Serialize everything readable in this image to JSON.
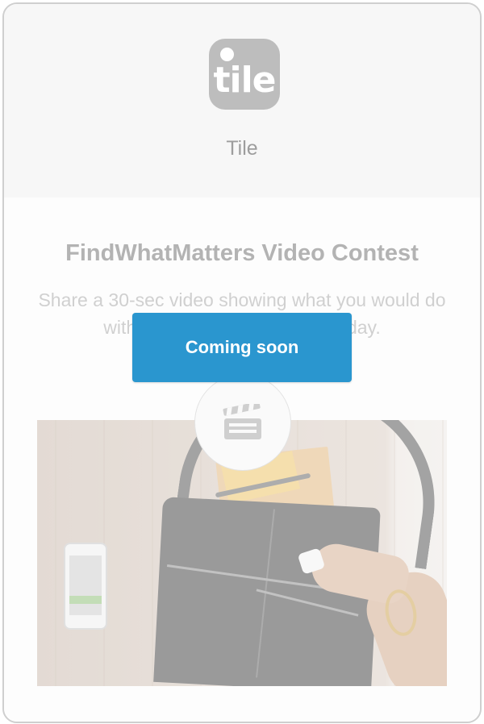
{
  "header": {
    "logo_text": "tile",
    "app_name": "Tile"
  },
  "main": {
    "title": "FindWhatMatters Video Contest",
    "description": "Share a 30-sec video showing what you would do with Tile that helps you every day.",
    "cta_label": "Coming soon"
  },
  "icons": {
    "video": "clapperboard-icon"
  },
  "colors": {
    "accent": "#2a96cf",
    "logo_bg": "#bdbdbd",
    "title_text": "#b3b3b3"
  }
}
